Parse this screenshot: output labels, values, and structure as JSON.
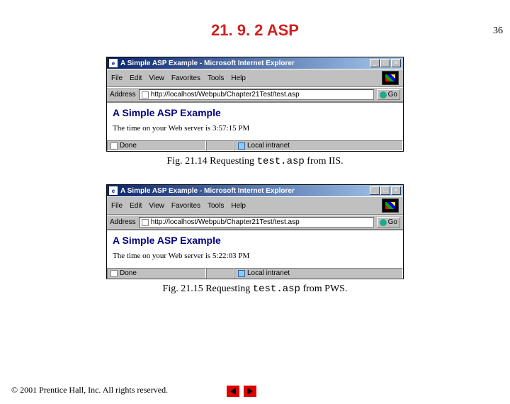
{
  "page_number": "36",
  "section_title": "21. 9. 2 ASP",
  "figures": [
    {
      "title": "A Simple ASP Example - Microsoft Internet Explorer",
      "menus": [
        "File",
        "Edit",
        "View",
        "Favorites",
        "Tools",
        "Help"
      ],
      "address_label": "Address",
      "url": "http://localhost/Webpub/Chapter21Test/test.asp",
      "go_label": "Go",
      "heading": "A Simple ASP Example",
      "body": "The time on your Web server is 3:57:15 PM",
      "status_done": "Done",
      "status_zone": "Local intranet",
      "caption_pre": "Fig. 21.14  Requesting ",
      "caption_code": "test.asp",
      "caption_post": " from IIS."
    },
    {
      "title": "A Simple ASP Example - Microsoft Internet Explorer",
      "menus": [
        "File",
        "Edit",
        "View",
        "Favorites",
        "Tools",
        "Help"
      ],
      "address_label": "Address",
      "url": "http://localhost/Webpub/Chapter21Test/test.asp",
      "go_label": "Go",
      "heading": "A Simple ASP Example",
      "body": "The time on your Web server is 5:22:03 PM",
      "status_done": "Done",
      "status_zone": "Local intranet",
      "caption_pre": "Fig. 21.15  Requesting ",
      "caption_code": "test.asp",
      "caption_post": " from PWS."
    }
  ],
  "copyright": "© 2001 Prentice Hall, Inc.  All rights reserved."
}
